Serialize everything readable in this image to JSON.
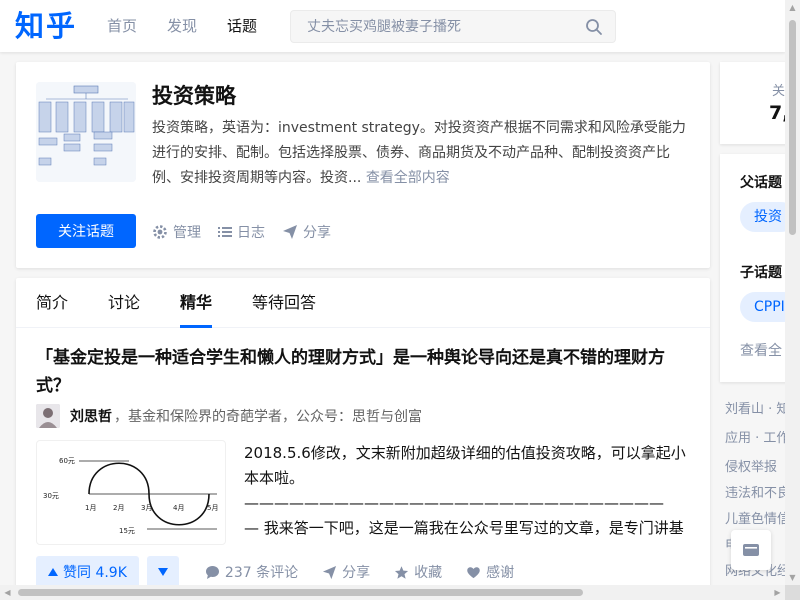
{
  "header": {
    "logo": "知乎",
    "nav": [
      "首页",
      "发现",
      "话题"
    ],
    "search_placeholder": "丈夫忘买鸡腿被妻子播死"
  },
  "topic": {
    "title": "投资策略",
    "description": "投资策略，英语为：investment strategy。对投资资产根据不同需求和风险承受能力进行的安排、配制。包括选择股票、债券、商品期货及不动产品种、配制投资资产比例、安排投资周期等内容。投资...",
    "more_link": "查看全部内容",
    "follow_label": "关注话题",
    "actions": {
      "manage": "管理",
      "log": "日志",
      "share": "分享"
    }
  },
  "tabs": [
    "简介",
    "讨论",
    "精华",
    "等待回答"
  ],
  "active_tab": 2,
  "answer": {
    "title": "「基金定投是一种适合学生和懒人的理财方式」是一种舆论导向还是真不错的理财方式？",
    "author_name": "刘思哲",
    "author_bio": "，基金和保险界的奇葩学者，公众号：思哲与创富",
    "excerpt_lines": [
      "2018.5.6修改，文末新附加超级详细的估值投资攻略，可以拿起小",
      "本本啦。",
      "————————————————————————————",
      "— 我来答一下吧，这是一篇我在公众号里写过的文章，是专门讲基"
    ],
    "cover_labels": {
      "y_top": "60元",
      "y_mid": "30元",
      "y_low": "15元",
      "months": [
        "1月",
        "2月",
        "3月",
        "4月",
        "5月"
      ]
    },
    "vote_label": "赞同 4.9K",
    "comments": "237 条评论",
    "share": "分享",
    "favorite": "收藏",
    "thanks": "感谢"
  },
  "sidebar": {
    "stat_label": "关",
    "stat_value": "7,",
    "parent_heading": "父话题",
    "parent_tag": "投资",
    "child_heading": "子话题",
    "child_tag": "CPPI",
    "child_more": "查看全",
    "links": [
      "刘看山 · 知",
      "应用 · 工作",
      "侵权举报",
      "违法和不良",
      "儿童色情信",
      "电",
      "网络文化经"
    ]
  },
  "colors": {
    "brand": "#0066ff",
    "muted": "#8590a6"
  }
}
